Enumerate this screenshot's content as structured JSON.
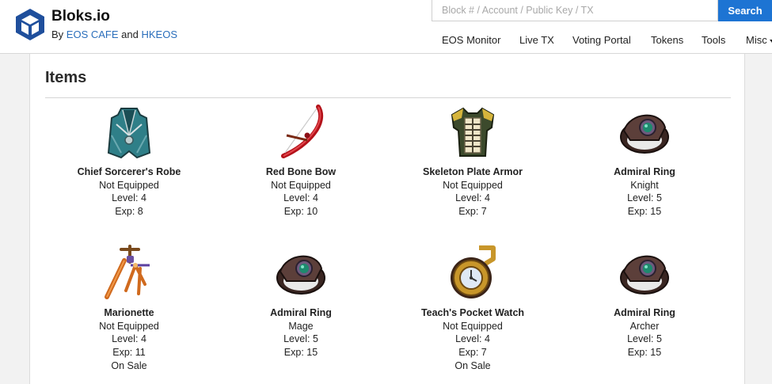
{
  "brand": {
    "title": "Bloks.io",
    "by": "By",
    "partner1": "EOS CAFE",
    "and": "and",
    "partner2": "HKEOS"
  },
  "search": {
    "placeholder": "Block # / Account / Public Key / TX",
    "button": "Search"
  },
  "nav": [
    "EOS Monitor",
    "Live TX",
    "Voting Portal",
    "Tokens",
    "Tools",
    "Misc"
  ],
  "section_title": "Items",
  "items": [
    {
      "icon": "robe-icon",
      "name": "Chief Sorcerer's Robe",
      "status": "Not Equipped",
      "level": "Level: 4",
      "exp": "Exp: 8",
      "extra": ""
    },
    {
      "icon": "bow-icon",
      "name": "Red Bone Bow",
      "status": "Not Equipped",
      "level": "Level: 4",
      "exp": "Exp: 10",
      "extra": ""
    },
    {
      "icon": "armor-icon",
      "name": "Skeleton Plate Armor",
      "status": "Not Equipped",
      "level": "Level: 4",
      "exp": "Exp: 7",
      "extra": ""
    },
    {
      "icon": "ring-icon",
      "name": "Admiral Ring",
      "status": "Knight",
      "level": "Level: 5",
      "exp": "Exp: 15",
      "extra": ""
    },
    {
      "icon": "marionette-icon",
      "name": "Marionette",
      "status": "Not Equipped",
      "level": "Level: 4",
      "exp": "Exp: 11",
      "extra": "On Sale"
    },
    {
      "icon": "ring-icon",
      "name": "Admiral Ring",
      "status": "Mage",
      "level": "Level: 5",
      "exp": "Exp: 15",
      "extra": ""
    },
    {
      "icon": "pocket-watch-icon",
      "name": "Teach's Pocket Watch",
      "status": "Not Equipped",
      "level": "Level: 4",
      "exp": "Exp: 7",
      "extra": "On Sale"
    },
    {
      "icon": "ring-icon",
      "name": "Admiral Ring",
      "status": "Archer",
      "level": "Level: 5",
      "exp": "Exp: 15",
      "extra": ""
    }
  ],
  "colors": {
    "accent": "#1d74d3",
    "link": "#2a6ebb",
    "logo": "#1f4f9c"
  }
}
